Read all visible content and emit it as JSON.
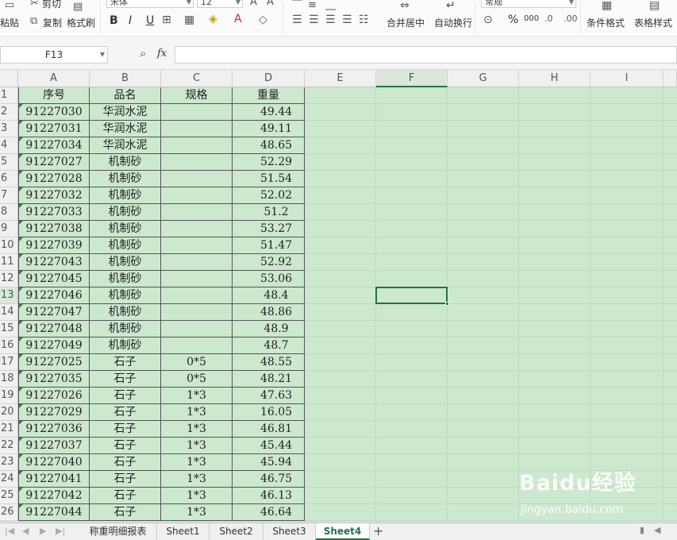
{
  "ribbon": {
    "cut_label": "剪切",
    "copy_label": "复制",
    "paste_label": "粘贴",
    "format_painter_label": "格式刷",
    "font_name": "宋体",
    "font_size": "12",
    "bold": "B",
    "italic": "I",
    "underline": "U",
    "merge_label": "合并居中",
    "wrap_label": "自动换行",
    "number_format": "常规",
    "percent": "%",
    "thousands": "000",
    "cond_format_label": "条件格式",
    "table_style_label": "表格样式"
  },
  "formula_bar": {
    "name_box": "F13",
    "fx": "fx",
    "formula": ""
  },
  "columns": [
    "A",
    "B",
    "C",
    "D",
    "E",
    "F",
    "G",
    "H",
    "I"
  ],
  "selected_column": "F",
  "selected_row": "13",
  "rows": [
    {
      "n": "1",
      "a": "序号",
      "b": "品名",
      "c": "规格",
      "d": "重量"
    },
    {
      "n": "2",
      "a": "91227030",
      "b": "华润水泥",
      "c": "",
      "d": "49.44"
    },
    {
      "n": "3",
      "a": "91227031",
      "b": "华润水泥",
      "c": "",
      "d": "49.11"
    },
    {
      "n": "4",
      "a": "91227034",
      "b": "华润水泥",
      "c": "",
      "d": "48.65"
    },
    {
      "n": "5",
      "a": "91227027",
      "b": "机制砂",
      "c": "",
      "d": "52.29"
    },
    {
      "n": "6",
      "a": "91227028",
      "b": "机制砂",
      "c": "",
      "d": "51.54"
    },
    {
      "n": "7",
      "a": "91227032",
      "b": "机制砂",
      "c": "",
      "d": "52.02"
    },
    {
      "n": "8",
      "a": "91227033",
      "b": "机制砂",
      "c": "",
      "d": "51.2"
    },
    {
      "n": "9",
      "a": "91227038",
      "b": "机制砂",
      "c": "",
      "d": "53.27"
    },
    {
      "n": "10",
      "a": "91227039",
      "b": "机制砂",
      "c": "",
      "d": "51.47"
    },
    {
      "n": "11",
      "a": "91227043",
      "b": "机制砂",
      "c": "",
      "d": "52.92"
    },
    {
      "n": "12",
      "a": "91227045",
      "b": "机制砂",
      "c": "",
      "d": "53.06"
    },
    {
      "n": "13",
      "a": "91227046",
      "b": "机制砂",
      "c": "",
      "d": "48.4"
    },
    {
      "n": "14",
      "a": "91227047",
      "b": "机制砂",
      "c": "",
      "d": "48.86"
    },
    {
      "n": "15",
      "a": "91227048",
      "b": "机制砂",
      "c": "",
      "d": "48.9"
    },
    {
      "n": "16",
      "a": "91227049",
      "b": "机制砂",
      "c": "",
      "d": "48.7"
    },
    {
      "n": "17",
      "a": "91227025",
      "b": "石子",
      "c": "0*5",
      "d": "48.55"
    },
    {
      "n": "18",
      "a": "91227035",
      "b": "石子",
      "c": "0*5",
      "d": "48.21"
    },
    {
      "n": "19",
      "a": "91227026",
      "b": "石子",
      "c": "1*3",
      "d": "47.63"
    },
    {
      "n": "20",
      "a": "91227029",
      "b": "石子",
      "c": "1*3",
      "d": "16.05"
    },
    {
      "n": "21",
      "a": "91227036",
      "b": "石子",
      "c": "1*3",
      "d": "46.81"
    },
    {
      "n": "22",
      "a": "91227037",
      "b": "石子",
      "c": "1*3",
      "d": "45.44"
    },
    {
      "n": "23",
      "a": "91227040",
      "b": "石子",
      "c": "1*3",
      "d": "45.94"
    },
    {
      "n": "24",
      "a": "91227041",
      "b": "石子",
      "c": "1*3",
      "d": "46.75"
    },
    {
      "n": "25",
      "a": "91227042",
      "b": "石子",
      "c": "1*3",
      "d": "46.13"
    },
    {
      "n": "26",
      "a": "91227044",
      "b": "石子",
      "c": "1*3",
      "d": "46.64"
    }
  ],
  "sheet_tabs": [
    "称重明细报表",
    "Sheet1",
    "Sheet2",
    "Sheet3",
    "Sheet4"
  ],
  "active_sheet": "Sheet4",
  "add_sheet": "+",
  "watermark": {
    "brand": "Baidu经验",
    "url": "jingyan.baidu.com"
  },
  "colors": {
    "sheet_background": "#cce8cf",
    "accent": "#217346"
  }
}
